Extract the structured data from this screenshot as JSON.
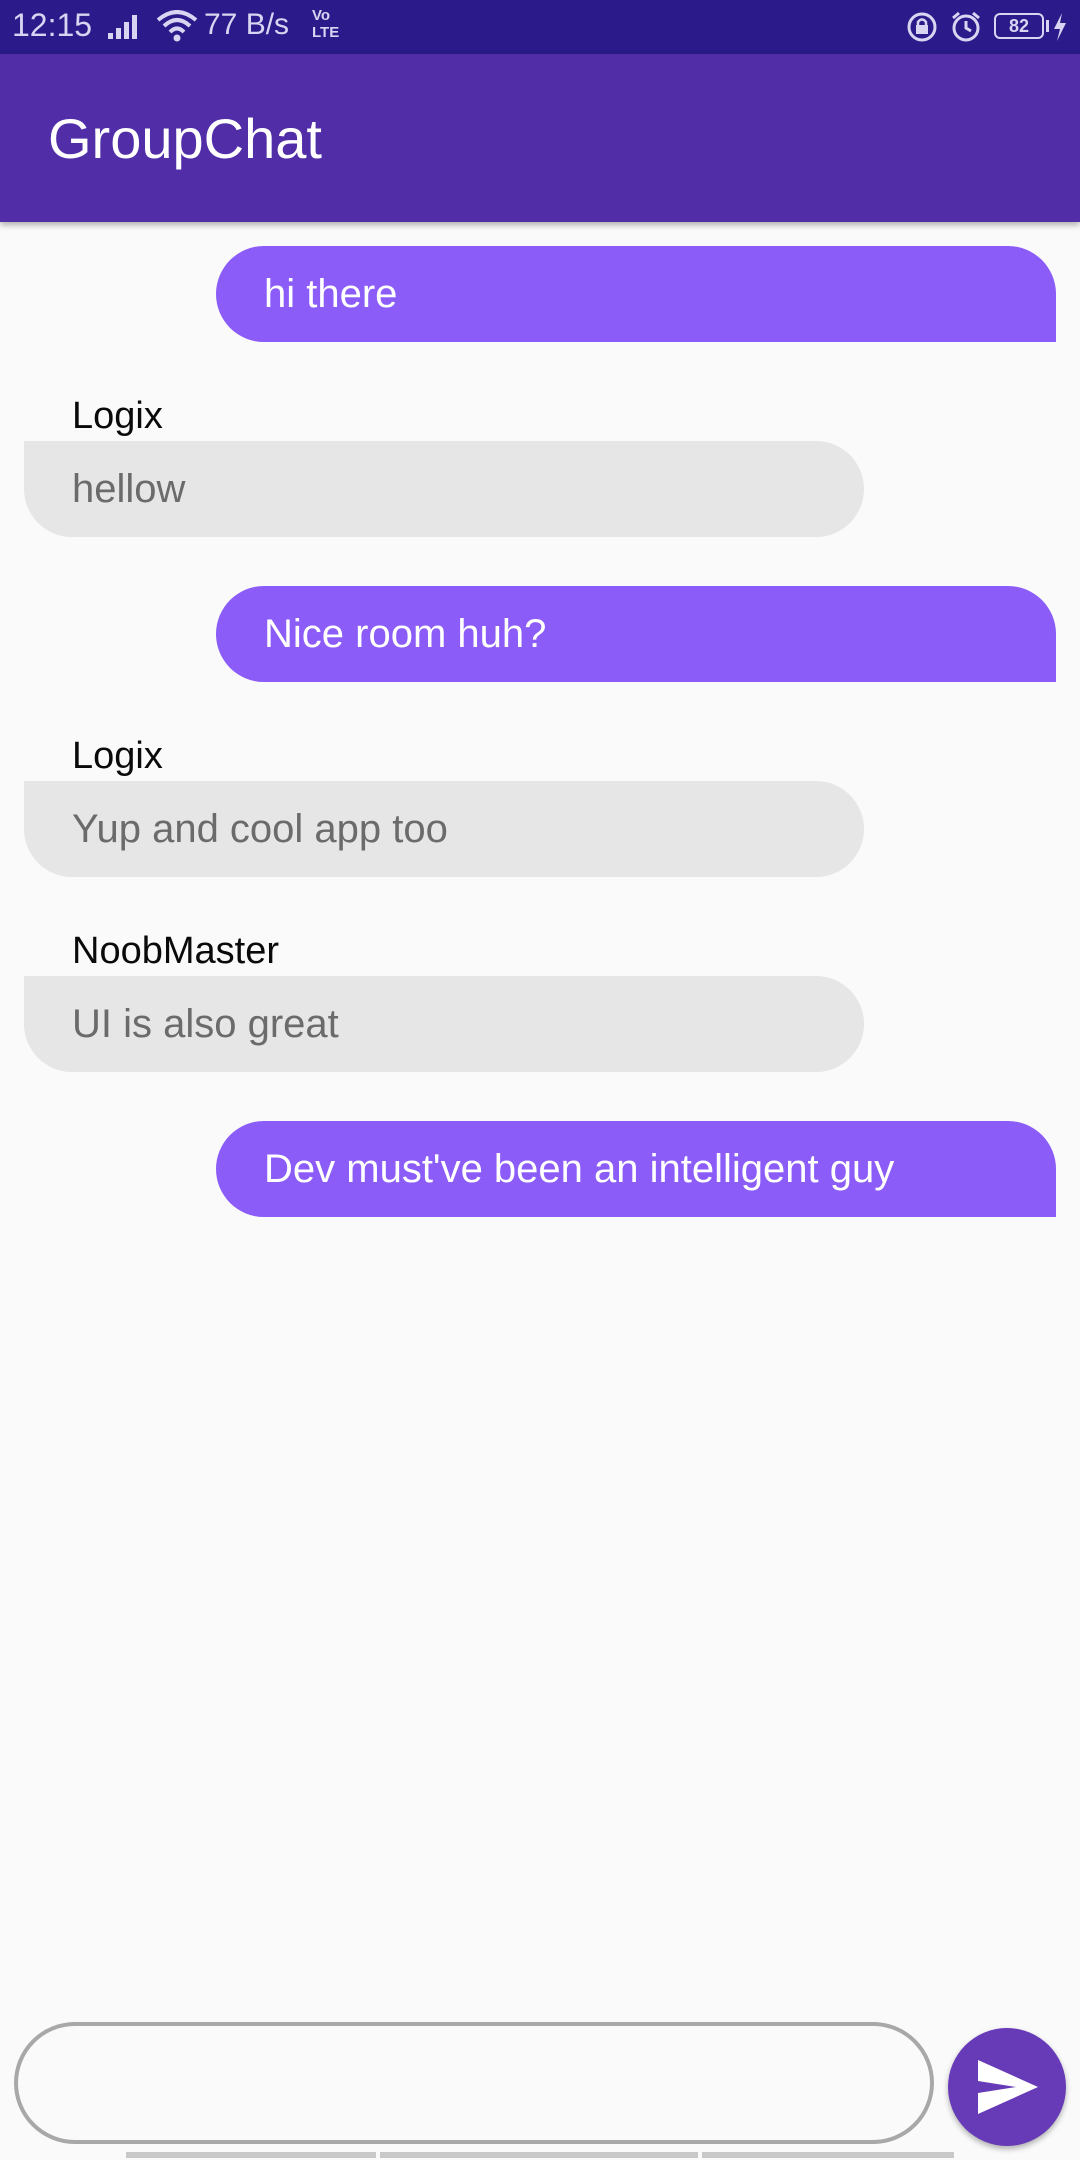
{
  "status_bar": {
    "time": "12:15",
    "net_speed": "77 B/s",
    "network_label": "Vo LTE",
    "battery": "82",
    "icons": [
      "signal-icon",
      "wifi-icon",
      "lock-rotation-icon",
      "alarm-icon",
      "battery-icon",
      "charging-icon"
    ]
  },
  "app_bar": {
    "title": "GroupChat",
    "color": "#512da8"
  },
  "messages": [
    {
      "direction": "outgoing",
      "sender": "",
      "text": "hi there"
    },
    {
      "direction": "incoming",
      "sender": "Logix",
      "text": "hellow"
    },
    {
      "direction": "outgoing",
      "sender": "",
      "text": "Nice room huh?"
    },
    {
      "direction": "incoming",
      "sender": "Logix",
      "text": "Yup and cool app too"
    },
    {
      "direction": "incoming",
      "sender": "NoobMaster",
      "text": "UI is also great"
    },
    {
      "direction": "outgoing",
      "sender": "",
      "text": "Dev must've been an intelligent guy"
    }
  ],
  "composer": {
    "value": "",
    "placeholder": "",
    "send_icon": "send-icon"
  },
  "colors": {
    "outgoing_bubble": "#8b5cf8",
    "incoming_bubble": "#e6e6e6",
    "send_button": "#673ab7",
    "status_bar": "#2a1a8a"
  }
}
